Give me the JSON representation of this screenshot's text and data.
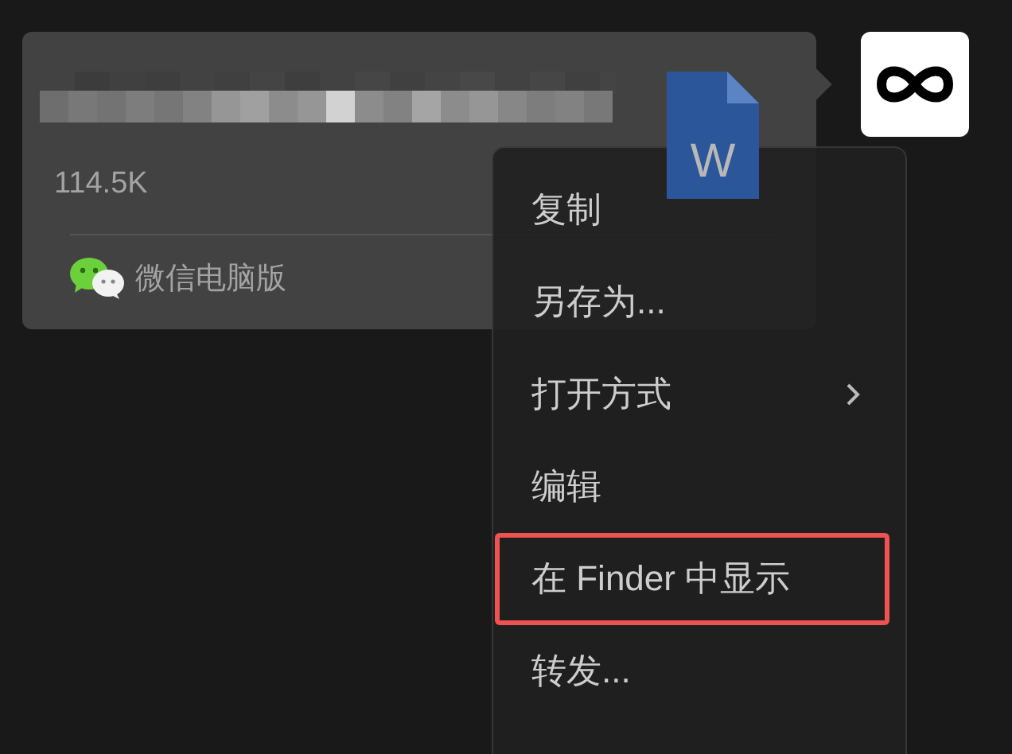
{
  "message": {
    "file_type_label": "W",
    "size": "114.5K",
    "source": "微信电脑版"
  },
  "context_menu": {
    "items": [
      {
        "label": "复制",
        "submenu": false,
        "highlighted": false
      },
      {
        "label": "另存为...",
        "submenu": false,
        "highlighted": false
      },
      {
        "label": "打开方式",
        "submenu": true,
        "highlighted": false
      },
      {
        "label": "编辑",
        "submenu": false,
        "highlighted": false
      },
      {
        "label": "在 Finder 中显示",
        "submenu": false,
        "highlighted": true
      },
      {
        "label": "转发...",
        "submenu": false,
        "highlighted": false
      }
    ]
  }
}
